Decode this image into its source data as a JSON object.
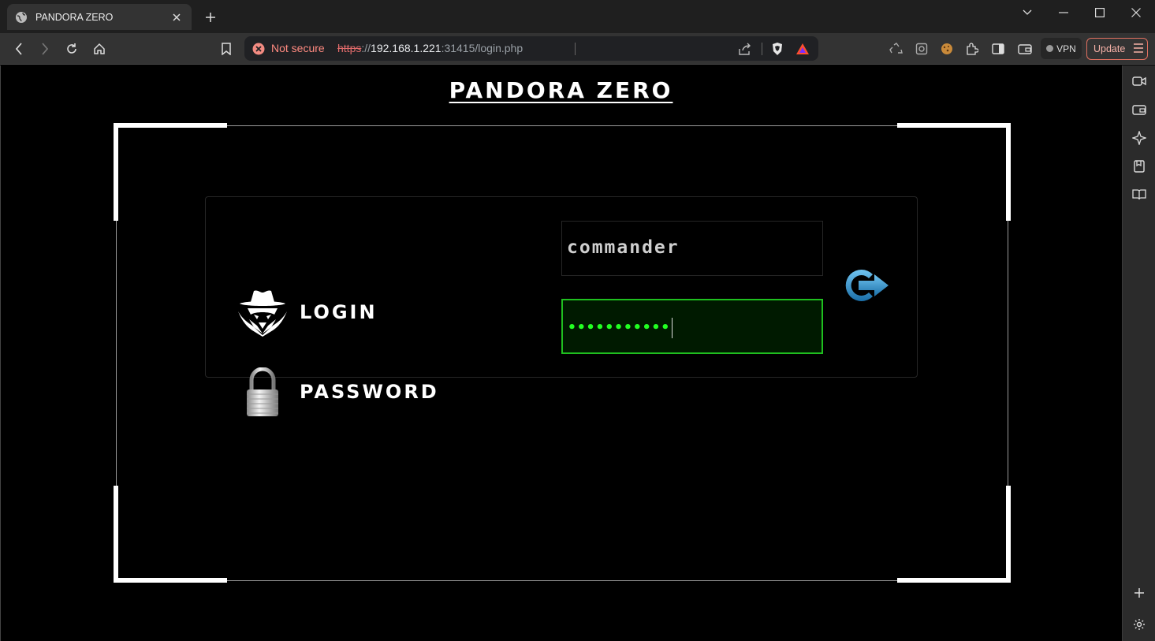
{
  "browser": {
    "tab": {
      "title": "PANDORA ZERO"
    },
    "omnibox": {
      "security_label": "Not secure",
      "url_scheme": "https",
      "url_sep": "://",
      "url_host": "192.168.1.221",
      "url_rest": ":31415/login.php"
    },
    "vpn_label": "VPN",
    "update_label": "Update"
  },
  "page": {
    "title": "PANDORA ZERO",
    "login_label": "LOGIN",
    "password_label": "PASSWORD",
    "username_value": "commander",
    "password_value": "•••••••••••"
  }
}
